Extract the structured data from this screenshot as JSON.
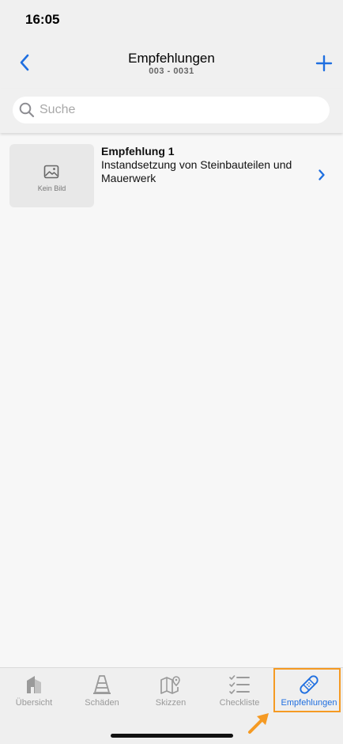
{
  "status_bar": {
    "time": "16:05"
  },
  "header": {
    "title": "Empfehlungen",
    "subtitle": "003 - 0031",
    "accent_color": "#1f6fe0"
  },
  "search": {
    "placeholder": "Suche",
    "value": ""
  },
  "list": {
    "items": [
      {
        "title": "Empfehlung 1",
        "description": "Instandsetzung von Steinbauteilen und Mauerwerk",
        "image_placeholder": "Kein Bild"
      }
    ]
  },
  "tab_bar": {
    "tabs": [
      {
        "label": "Übersicht",
        "icon": "building-icon",
        "active": false
      },
      {
        "label": "Schäden",
        "icon": "traffic-cone-icon",
        "active": false
      },
      {
        "label": "Skizzen",
        "icon": "map-pin-icon",
        "active": false
      },
      {
        "label": "Checkliste",
        "icon": "checklist-icon",
        "active": false
      },
      {
        "label": "Empfehlungen",
        "icon": "bandage-icon",
        "active": true
      }
    ],
    "highlight_color": "#f59a23"
  }
}
